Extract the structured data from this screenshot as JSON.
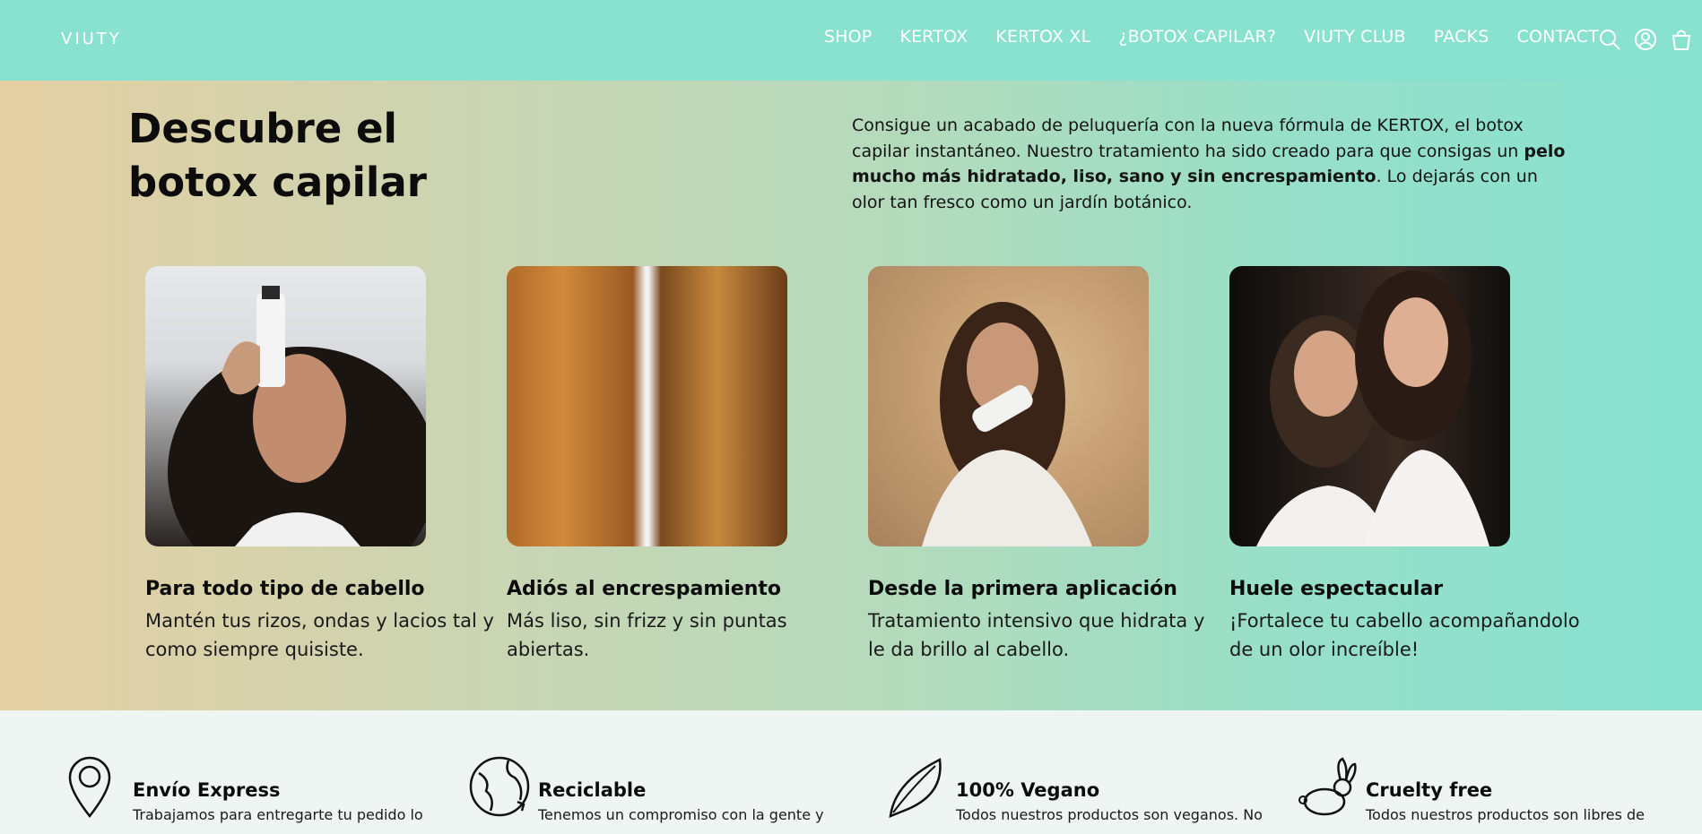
{
  "header": {
    "logo": "VIUTY",
    "nav": [
      "SHOP",
      "KERTOX",
      "KERTOX XL",
      "¿BOTOX CAPILAR?",
      "VIUTY CLUB",
      "PACKS",
      "CONTACT"
    ],
    "icons": [
      "search-icon",
      "account-icon",
      "cart-icon"
    ]
  },
  "hero": {
    "title": "Descubre el botox capilar",
    "desc_part1": "Consigue un acabado de peluquería con la nueva fórmula de KERTOX, el botox capilar instantáneo. Nuestro tratamiento ha sido creado para que consigas un ",
    "desc_bold": "pelo mucho más hidratado, liso, sano y sin encrespamiento",
    "desc_part2": ". Lo dejarás con un olor tan fresco como un jardín botánico."
  },
  "cards": [
    {
      "title": "Para todo tipo de cabello",
      "text": "Mantén tus rizos, ondas y lacios tal y como siempre quisiste."
    },
    {
      "title": "Adiós al encrespamiento",
      "text": "Más liso, sin frizz y sin puntas abiertas."
    },
    {
      "title": "Desde la primera aplicación",
      "text": "Tratamiento intensivo que hidrata y le da brillo al cabello."
    },
    {
      "title": "Huele espectacular",
      "text": "¡Fortalece tu cabello acompañandolo de un olor increíble!"
    }
  ],
  "features": [
    {
      "icon": "location-pin-icon",
      "title": "Envío Express",
      "desc": "Trabajamos para entregarte tu pedido lo"
    },
    {
      "icon": "recycle-globe-icon",
      "title": "Reciclable",
      "desc": "Tenemos un compromiso con la gente y"
    },
    {
      "icon": "leaf-icon",
      "title": "100% Vegano",
      "desc": "Todos nuestros productos son veganos. No"
    },
    {
      "icon": "rabbit-icon",
      "title": "Cruelty free",
      "desc": "Todos nuestros productos son libres de"
    }
  ],
  "colors": {
    "header_bg": "#89e2d0",
    "gradient_start": "#e4cfa3",
    "gradient_end": "#87e2d0"
  }
}
